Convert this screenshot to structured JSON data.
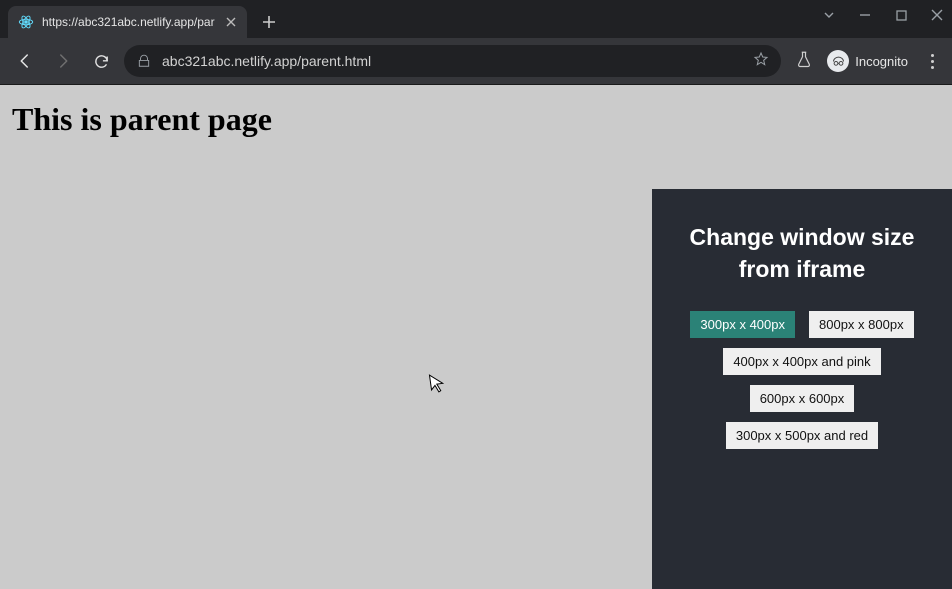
{
  "window": {
    "tab_title": "https://abc321abc.netlify.app/par",
    "url": "abc321abc.netlify.app/parent.html",
    "incognito_label": "Incognito"
  },
  "page": {
    "heading": "This is parent page"
  },
  "iframe": {
    "title_line1": "Change window size",
    "title_line2": "from iframe",
    "buttons": [
      {
        "label": "300px x 400px",
        "active": true
      },
      {
        "label": "800px x 800px",
        "active": false
      },
      {
        "label": "400px x 400px and pink",
        "active": false
      },
      {
        "label": "600px x 600px",
        "active": false
      },
      {
        "label": "300px x 500px and red",
        "active": false
      }
    ]
  }
}
